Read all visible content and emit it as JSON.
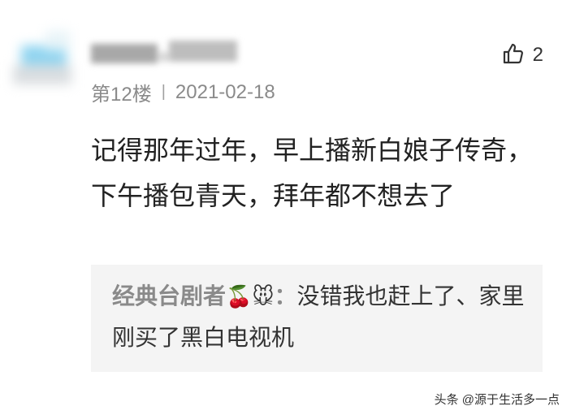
{
  "comment": {
    "floor_label": "第12楼",
    "separator": "|",
    "date": "2021-02-18",
    "like_count": "2",
    "like_icon": "thumbs-up-outline-icon",
    "text": "记得那年过年，早上播新白娘子传奇，下午播包青天，拜年都不想去了"
  },
  "reply": {
    "author": "经典台剧者",
    "author_emoji": "🍒🐭",
    "colon": "：",
    "text": "没错我也赶上了、家里刚买了黑白电视机"
  },
  "watermark": "头条 @源于生活多一点",
  "colors": {
    "meta_gray": "#8a8a8a",
    "reply_background": "#f4f4f4",
    "text": "#222222"
  }
}
